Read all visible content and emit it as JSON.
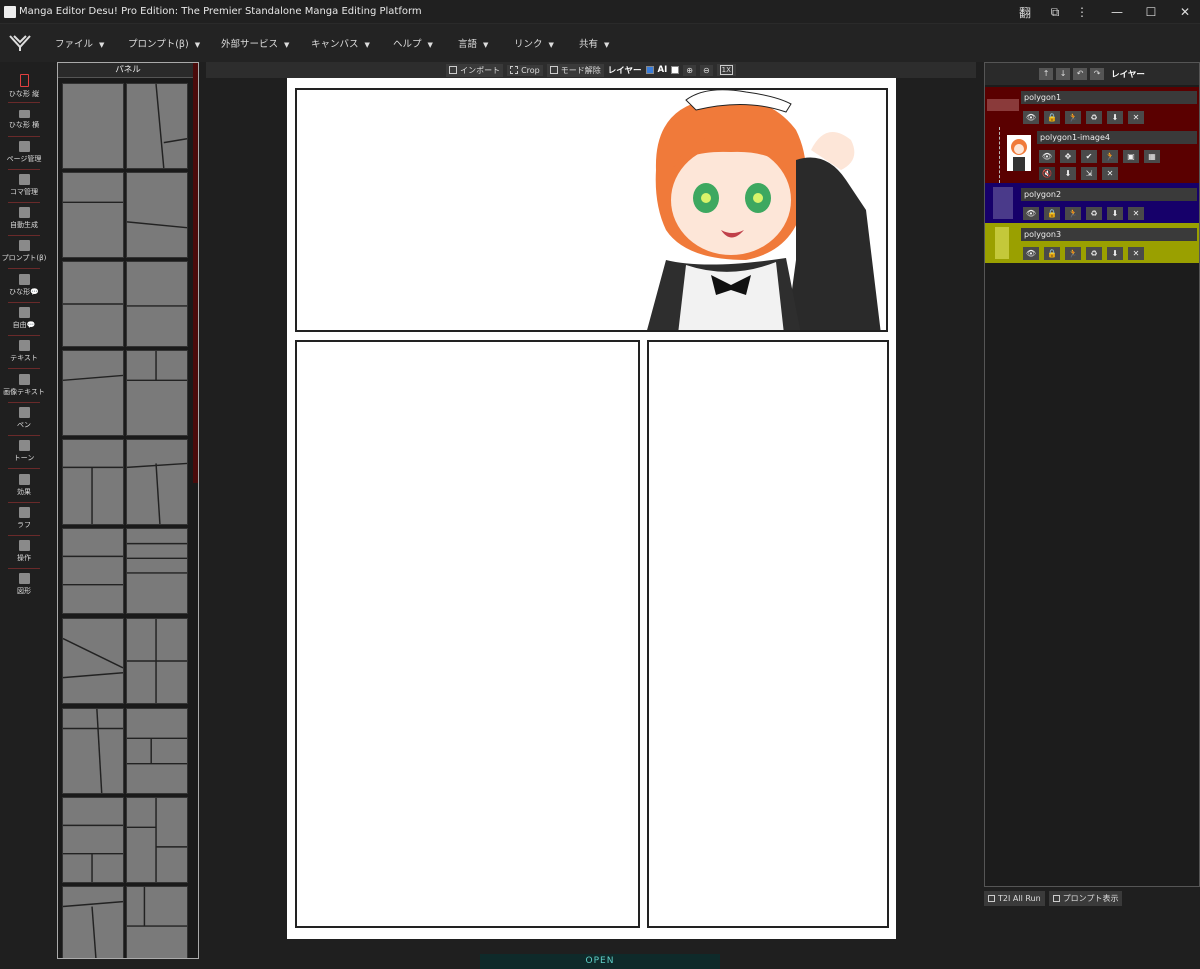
{
  "window": {
    "title": "Manga Editor Desu! Pro Edition: The Premier Standalone Manga Editing Platform",
    "controls": [
      "翻",
      "⧉",
      "⋮",
      "—",
      "☐",
      "✕"
    ]
  },
  "menu": [
    {
      "label": "ファイル"
    },
    {
      "label": "プロンプト(β)"
    },
    {
      "label": "外部サービス"
    },
    {
      "label": "キャンバス"
    },
    {
      "label": "ヘルプ"
    },
    {
      "label": "言語"
    },
    {
      "label": "リンク"
    },
    {
      "label": "共有"
    }
  ],
  "tools": [
    {
      "label": "ひな形 縦",
      "icon": "portrait-rect-icon",
      "active": true
    },
    {
      "label": "ひな形 横",
      "icon": "landscape-rect-icon"
    },
    {
      "label": "ページ管理",
      "icon": "grid-icon"
    },
    {
      "label": "コマ管理",
      "icon": "panels-icon"
    },
    {
      "label": "自動生成",
      "icon": "robot-icon"
    },
    {
      "label": "プロンプト(β)",
      "icon": "clipboard-icon"
    },
    {
      "label": "ひな形💬",
      "icon": "speech-bubble-icon"
    },
    {
      "label": "自由💬",
      "icon": "add-bubble-icon"
    },
    {
      "label": "テキスト",
      "icon": "text-icon"
    },
    {
      "label": "画像テキスト",
      "icon": "image-text-icon"
    },
    {
      "label": "ペン",
      "icon": "pen-icon"
    },
    {
      "label": "トーン",
      "icon": "tone-icon"
    },
    {
      "label": "効果",
      "icon": "effect-icon"
    },
    {
      "label": "ラフ",
      "icon": "sketch-icon"
    },
    {
      "label": "操作",
      "icon": "gamepad-icon"
    },
    {
      "label": "図形",
      "icon": "shapes-icon"
    }
  ],
  "panel_list": {
    "header": "パネル"
  },
  "toolbar": {
    "import_label": "インポート",
    "crop_label": "Crop",
    "mode_off_label": "モード解除",
    "layer_label": "レイヤー",
    "ai_label": "AI",
    "ai_checked": true,
    "zoom_in": "⊕",
    "zoom_out": "⊖",
    "reset_zoom": "1X"
  },
  "layers_panel": {
    "title": "レイヤー",
    "buttons": [
      "↑",
      "↓",
      "↶",
      "↷"
    ],
    "layers": [
      {
        "name": "polygon1",
        "color": "#5a0000"
      },
      {
        "name": "polygon1-image4",
        "color": "#5a0000"
      },
      {
        "name": "polygon2",
        "color": "#16006a"
      },
      {
        "name": "polygon3",
        "color": "#9aa000"
      }
    ],
    "layer_icons": [
      "👁",
      "🔒",
      "🏃",
      "♻",
      "⬇",
      "✕"
    ],
    "image_icons_row1": [
      "👁",
      "✥",
      "✔",
      "🏃",
      "▣",
      "▦"
    ],
    "image_icons_row2": [
      "🔇",
      "⬇",
      "⇲",
      "✕"
    ]
  },
  "footer_buttons": {
    "t2i_label": "T2I All Run",
    "prompt_label": "プロンプト表示"
  },
  "status": {
    "open_label": "OPEN"
  }
}
